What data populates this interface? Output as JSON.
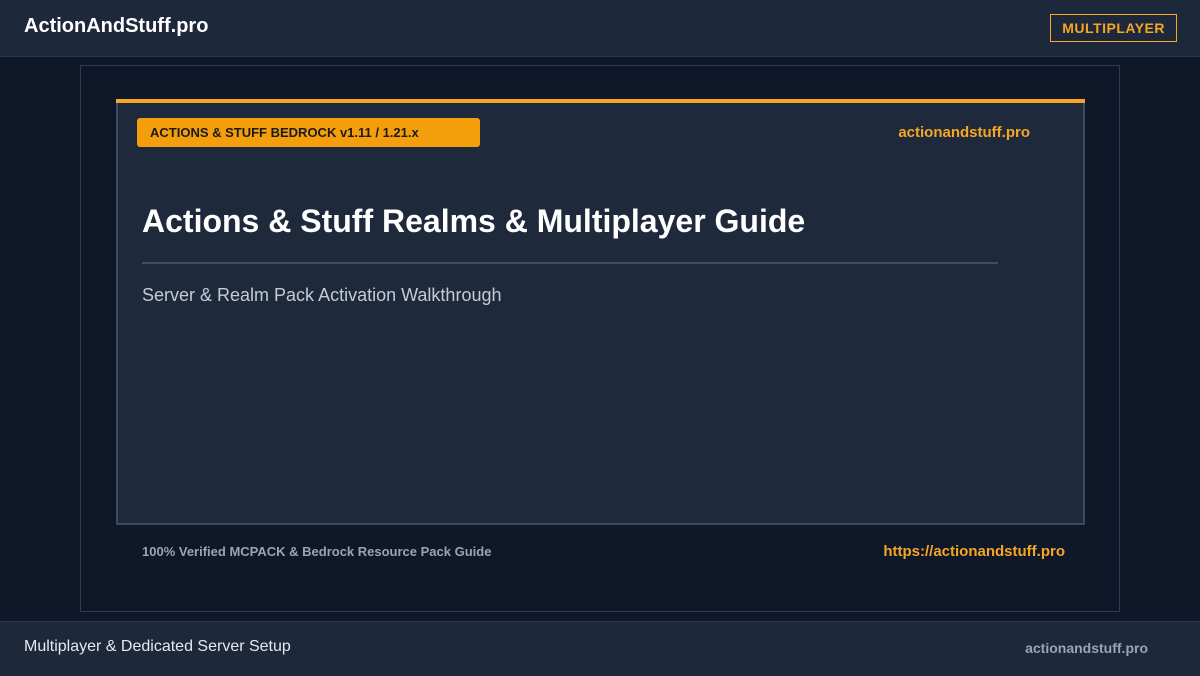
{
  "header": {
    "site_name": "ActionAndStuff.pro",
    "badge": "MULTIPLAYER"
  },
  "card": {
    "version_badge": "ACTIONS & STUFF BEDROCK v1.11 / 1.21.x",
    "domain": "actionandstuff.pro",
    "title": "Actions & Stuff Realms & Multiplayer Guide",
    "subtitle": "Server & Realm Pack Activation Walkthrough"
  },
  "frame_footer": {
    "note": "100% Verified MCPACK & Bedrock Resource Pack Guide",
    "url": "https://actionandstuff.pro"
  },
  "footer": {
    "left_text": "Multiplayer & Dedicated Server Setup",
    "right_text": "actionandstuff.pro"
  },
  "colors": {
    "accent": "#f5a623",
    "background": "#0f1829",
    "card": "#1e293b"
  }
}
